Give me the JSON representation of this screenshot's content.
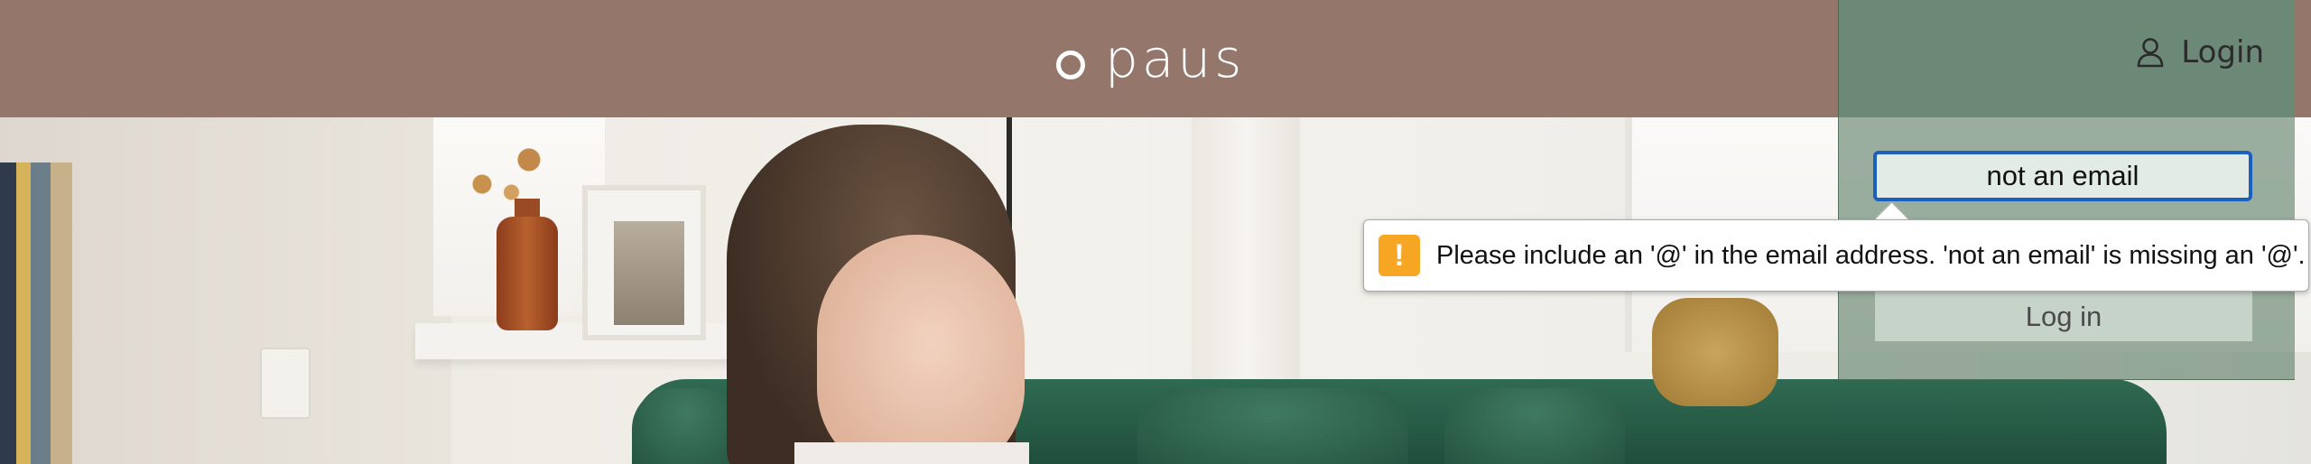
{
  "header": {
    "logo_text": "paus",
    "brand_color": "#94766b"
  },
  "login_panel": {
    "login_link_label": "Login",
    "user_icon": "user-icon",
    "email_value": "not an email",
    "login_button_label": "Log in",
    "panel_color": "#6c8978"
  },
  "validation": {
    "message": "Please include an '@' in the email address. 'not an email' is missing an '@'.",
    "icon": "warning-icon",
    "icon_glyph": "!",
    "icon_color": "#f6a623"
  }
}
